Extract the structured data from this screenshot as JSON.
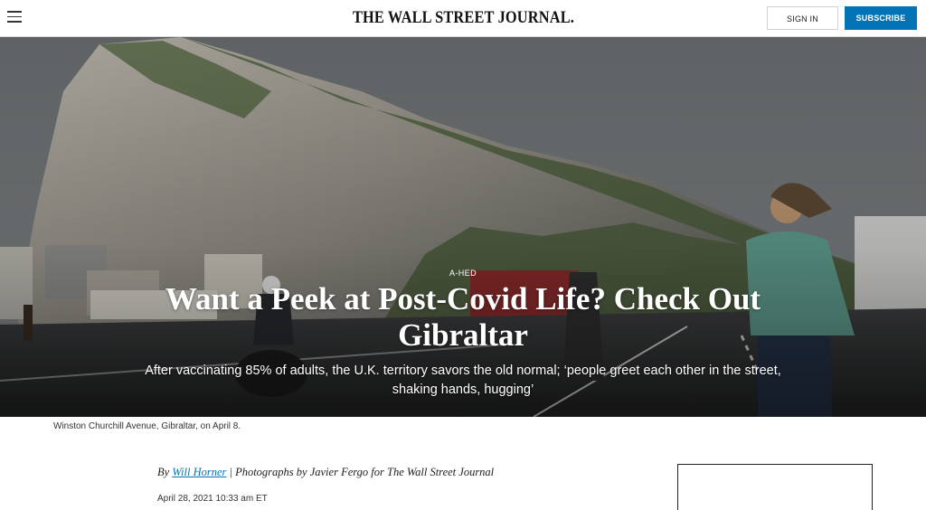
{
  "header": {
    "masthead": "THE WALL STREET JOURNAL.",
    "sign_in_label": "SIGN IN",
    "subscribe_label": "SUBSCRIBE",
    "menu_icon": "hamburger-menu-icon",
    "subscribe_color": "#0274b6"
  },
  "hero": {
    "label": "A-HED",
    "title": "Want a Peek at Post-Covid Life? Check Out Gibraltar",
    "dek": "After vaccinating 85% of adults, the U.K. territory savors the old normal; ‘people greet each other in the street, shaking hands, hugging’"
  },
  "caption": "Winston Churchill Avenue, Gibraltar, on April 8.",
  "article": {
    "byline_prefix": "By",
    "author": "Will Horner",
    "photo_credit": " | Photographs by Javier Fergo for The Wall Street Journal",
    "date": "April 28, 2021 10:33 am ET"
  }
}
